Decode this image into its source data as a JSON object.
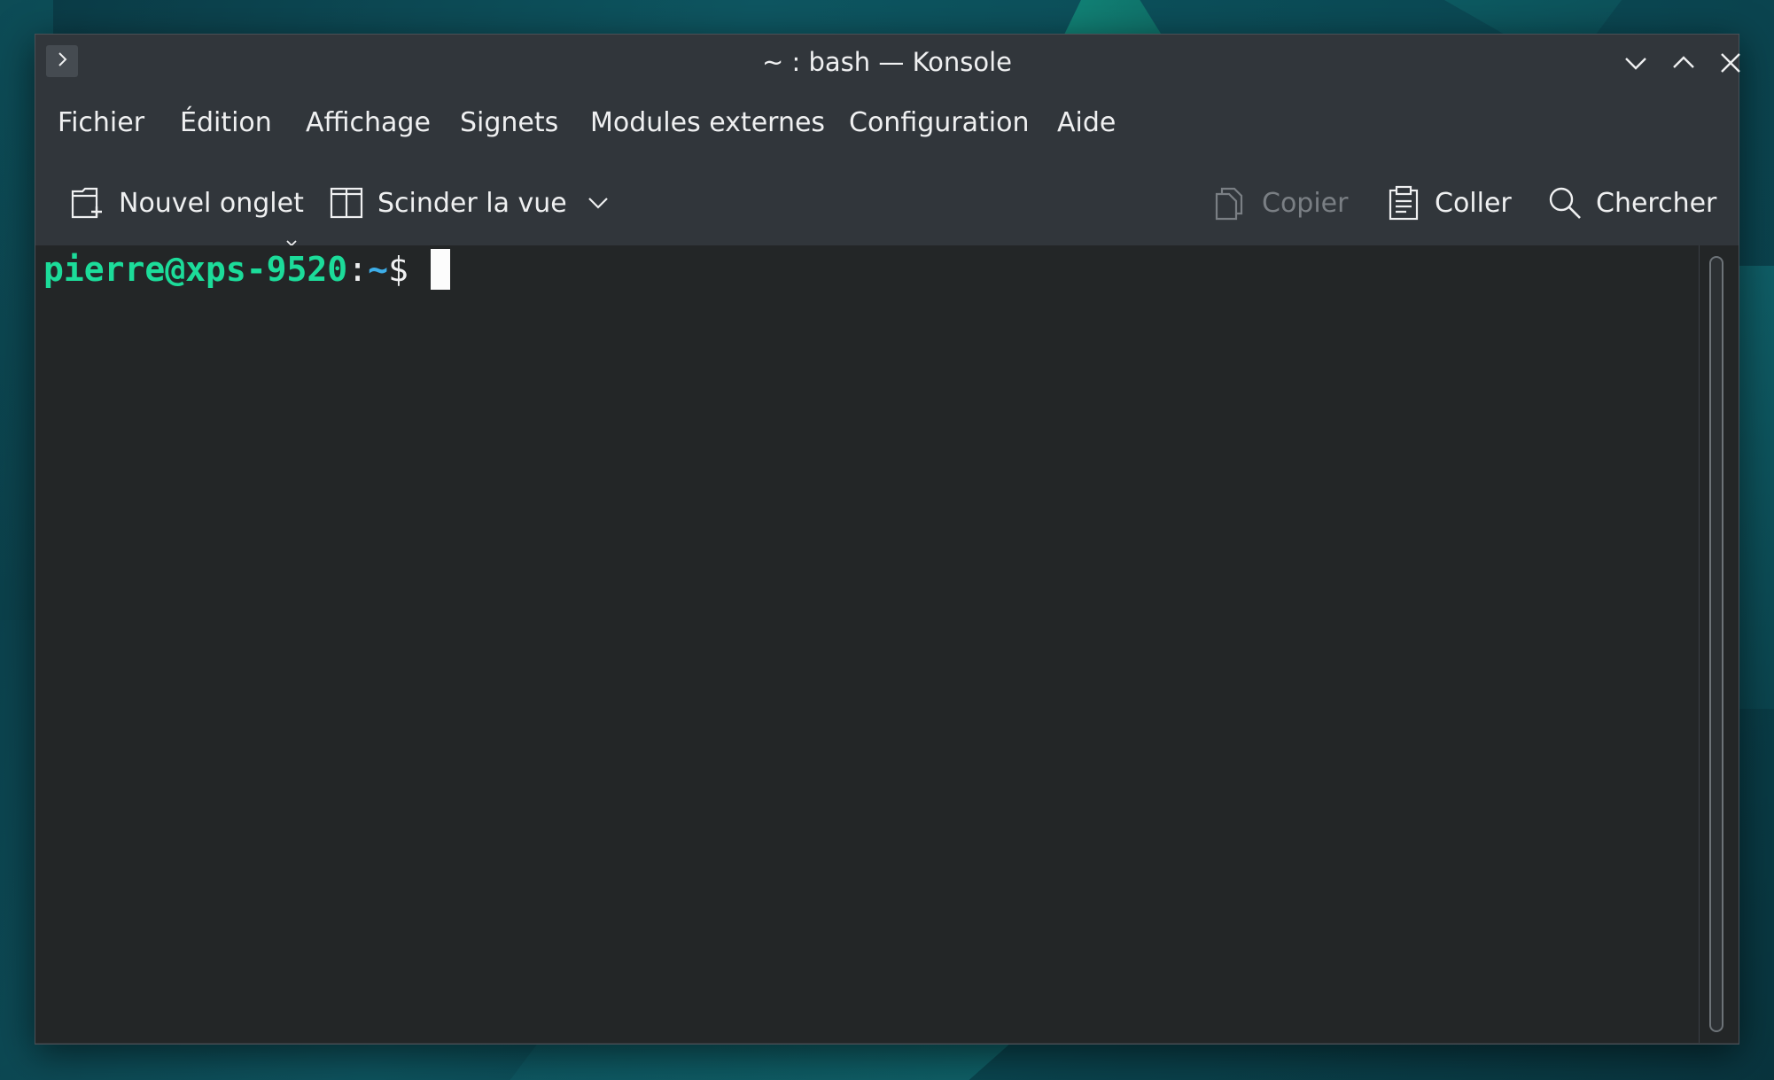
{
  "window": {
    "title": "~ : bash — Konsole"
  },
  "menubar": {
    "items": [
      {
        "label": "Fichier"
      },
      {
        "label": "Édition"
      },
      {
        "label": "Affichage"
      },
      {
        "label": "Signets"
      },
      {
        "label": "Modules externes"
      },
      {
        "label": "Configuration"
      },
      {
        "label": "Aide"
      }
    ]
  },
  "toolbar": {
    "new_tab": "Nouvel onglet",
    "split_view": "Scinder la vue",
    "copy": "Copier",
    "paste": "Coller",
    "search": "Chercher"
  },
  "terminal": {
    "user_host": "pierre@xps-9520",
    "separator": ":",
    "path": "~",
    "prompt_symbol": "$"
  },
  "colors": {
    "window_bg": "#31363b",
    "terminal_bg": "#232627",
    "prompt_user": "#1cdc9a",
    "prompt_path": "#3daee9",
    "text": "#eff0f1",
    "disabled_text": "#7a7f84"
  },
  "icons": {
    "app_menu": "chevron-right-icon",
    "minimize": "chevron-down-icon",
    "maximize": "chevron-up-icon",
    "close": "close-icon",
    "new_tab": "new-tab-icon",
    "split_view": "split-view-icon",
    "copy": "copy-icon",
    "paste": "paste-icon",
    "search": "search-icon"
  }
}
